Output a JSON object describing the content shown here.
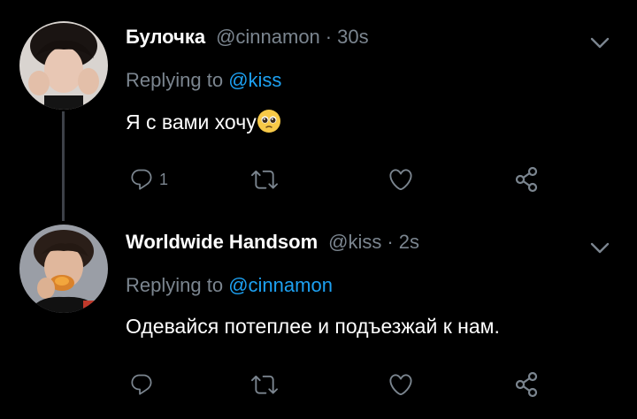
{
  "tweets": [
    {
      "name": "Булочка",
      "handle": "@cinnamon",
      "separator": "·",
      "time": "30s",
      "replying_prefix": "Replying to",
      "replying_to": "@kiss",
      "text": "Я с вами хочу",
      "emoji": "pleading-face-emoji",
      "reply_count": "1"
    },
    {
      "name": "Worldwide Handsom",
      "handle": "@kiss",
      "separator": "·",
      "time": "2s",
      "replying_prefix": "Replying to",
      "replying_to": "@cinnamon",
      "text": "Одевайся потеплее и подъезжай к нам.",
      "reply_count": ""
    }
  ],
  "icons": {
    "reply": "reply-icon",
    "retweet": "retweet-icon",
    "like": "heart-icon",
    "share": "share-icon",
    "more": "chevron-down-icon"
  },
  "colors": {
    "background": "#000000",
    "secondary_text": "#7b858f",
    "link": "#1da1f2",
    "thread_line": "#3d4148"
  }
}
